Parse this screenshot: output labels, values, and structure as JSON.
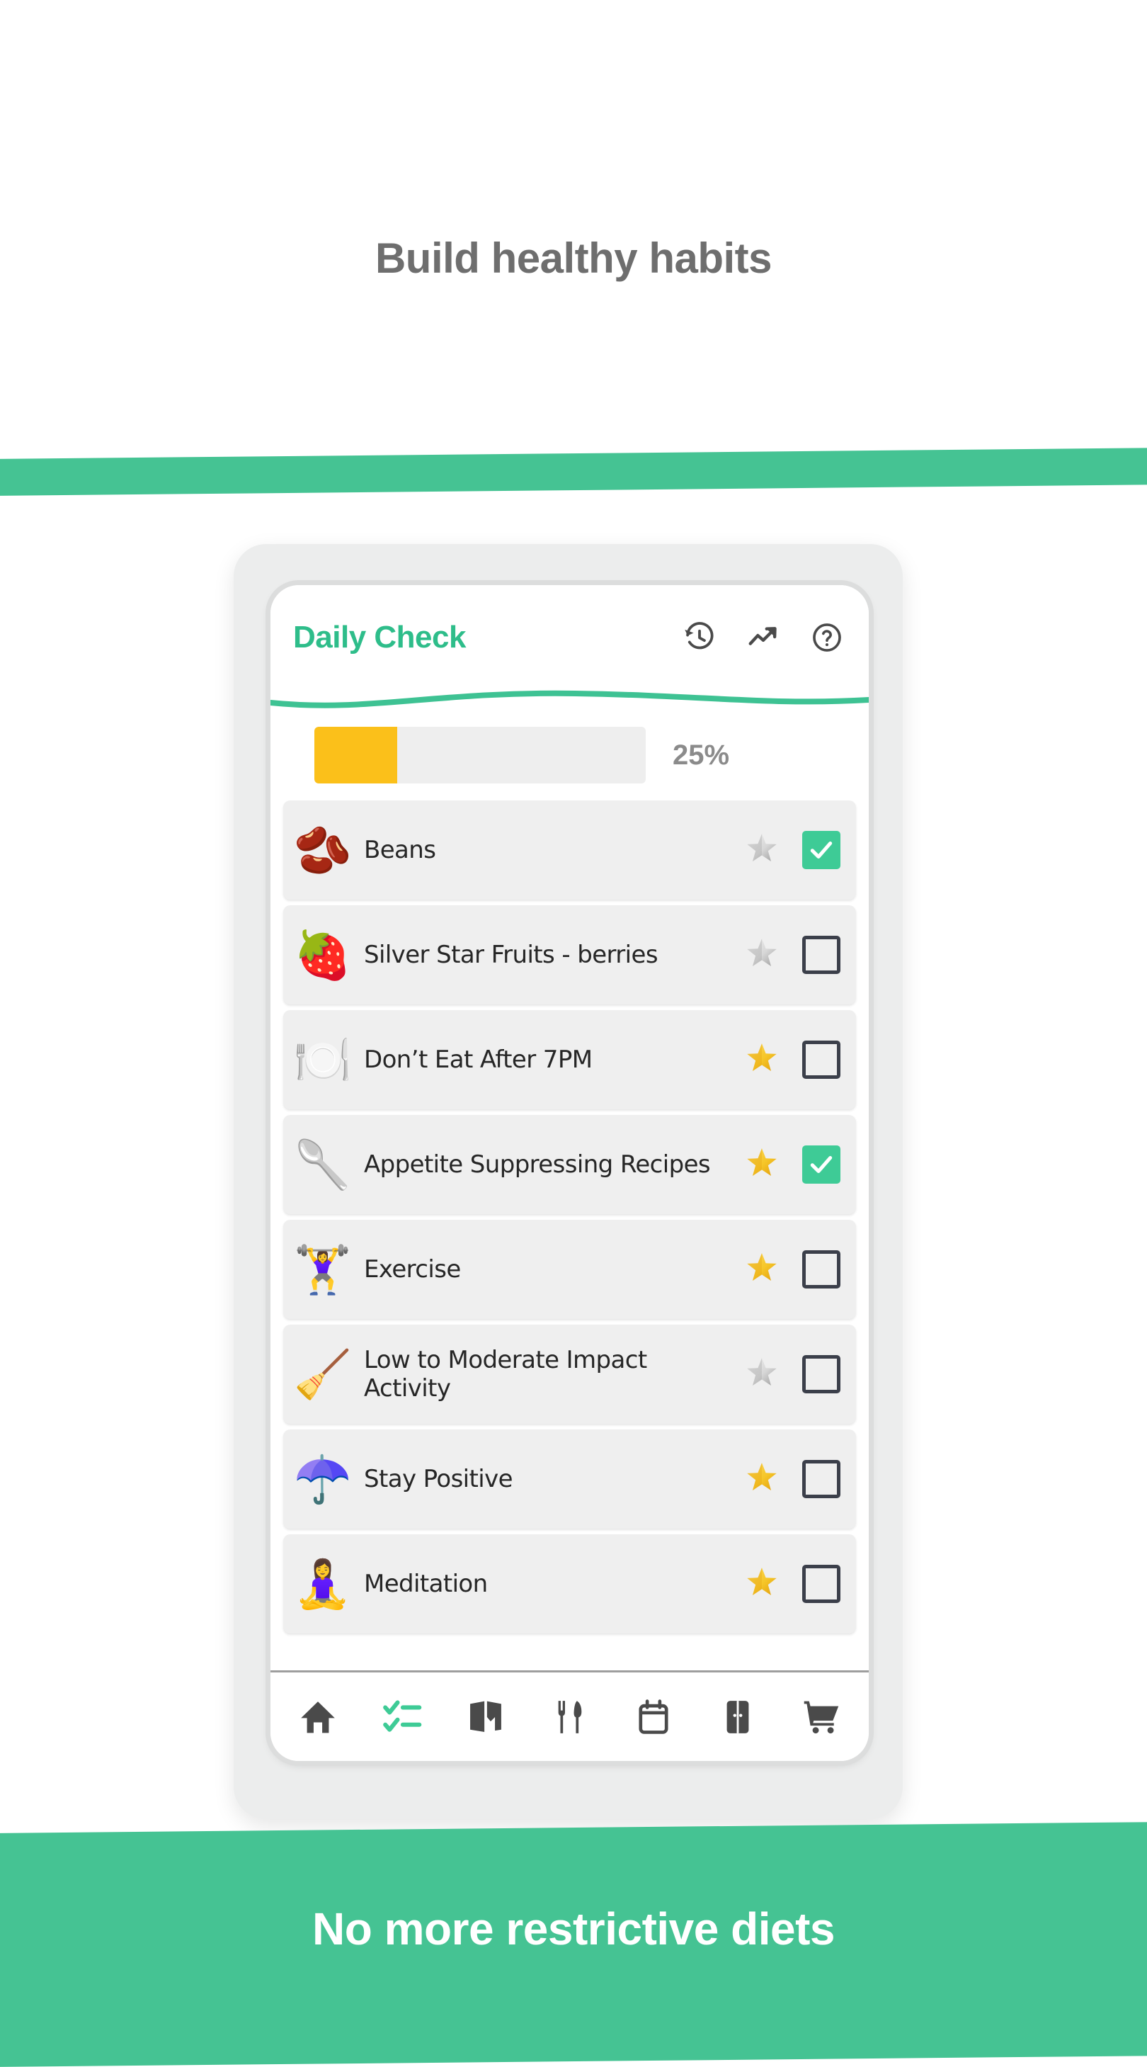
{
  "headline": "Build healthy habits",
  "footer_banner": {
    "text": "No more restrictive diets",
    "background_color": "#45c393",
    "text_color": "#ffffff"
  },
  "theme": {
    "brand_green": "#45c393",
    "title_green": "#2ebd8a",
    "checkbox_green": "#3ecb96",
    "progress_amber": "#fbc01a",
    "row_gray": "#efefef",
    "phone_body_gray": "#eceded",
    "headline_gray": "#6e6e6e"
  },
  "app": {
    "title": "Daily Check",
    "header_icons": [
      {
        "name": "history-icon",
        "label": "History"
      },
      {
        "name": "trending-up-icon",
        "label": "Progress"
      },
      {
        "name": "help-circle-icon",
        "label": "Help"
      }
    ],
    "progress": {
      "percent_value": 25,
      "percent_label": "25%",
      "fill_color": "#fbc01a",
      "track_color": "#eeeeee"
    },
    "habits": [
      {
        "label": "Beans",
        "emoji": "🫘",
        "icon_name": "beans-icon",
        "star": "silver",
        "star_emoji": "⭐",
        "checked": true
      },
      {
        "label": "Silver Star Fruits - berries",
        "emoji": "🍓",
        "icon_name": "berries-icon",
        "star": "silver",
        "star_emoji": "⭐",
        "checked": false
      },
      {
        "label": "Don’t Eat After 7PM",
        "emoji": "🍽️",
        "icon_name": "no-eating-after-7pm-icon",
        "star": "gold",
        "star_emoji": "⭐",
        "checked": false
      },
      {
        "label": "Appetite Suppressing Recipes",
        "emoji": "🥄",
        "icon_name": "cooking-utensils-icon",
        "star": "gold",
        "star_emoji": "⭐",
        "checked": true
      },
      {
        "label": "Exercise",
        "emoji": "🏋️‍♀️",
        "icon_name": "exercise-icon",
        "star": "gold",
        "star_emoji": "⭐",
        "checked": false
      },
      {
        "label": "Low to Moderate Impact Activity",
        "emoji": "🧹",
        "icon_name": "low-impact-activity-icon",
        "star": "silver",
        "star_emoji": "⭐",
        "checked": false
      },
      {
        "label": "Stay Positive",
        "emoji": "☂️",
        "icon_name": "stay-positive-icon",
        "star": "gold",
        "star_emoji": "⭐",
        "checked": false
      },
      {
        "label": "Meditation",
        "emoji": "🧘‍♀️",
        "icon_name": "meditation-icon",
        "star": "gold",
        "star_emoji": "⭐",
        "checked": false
      }
    ],
    "bottom_nav": [
      {
        "name": "home-icon",
        "label": "Home",
        "active": false
      },
      {
        "name": "checklist-icon",
        "label": "Daily Check",
        "active": true
      },
      {
        "name": "book-icon",
        "label": "Guide",
        "active": false
      },
      {
        "name": "fork-knife-icon",
        "label": "Meals",
        "active": false
      },
      {
        "name": "calendar-icon",
        "label": "Calendar",
        "active": false
      },
      {
        "name": "fridge-icon",
        "label": "Fridge",
        "active": false
      },
      {
        "name": "shopping-cart-icon",
        "label": "Shopping",
        "active": false
      }
    ]
  }
}
